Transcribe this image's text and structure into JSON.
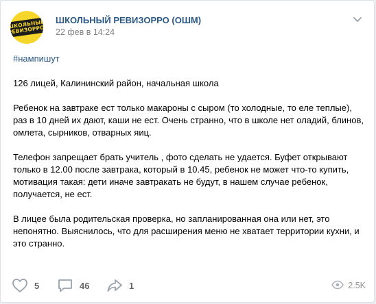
{
  "post": {
    "author": "ШКОЛЬНЫЙ РЕВИЗОРРО (ОШМ)",
    "date": "22 фев в 14:24",
    "avatar_text_line1": "ШКОЛЬНЫЙ",
    "avatar_text_line2": "РЕВИЗОРРО",
    "hashtag": "#нампишут",
    "paragraphs": [
      "126 лицей, Калининский район, начальная школа",
      "Ребенок на завтраке ест только макароны с сыром (то холодные, то еле теплые), раз в 10 дней их дают, каши не ест. Очень странно, что в школе нет оладий, блинов, омлета, сырников, отварных яиц.",
      "Телефон запрещает брать учитель , фото сделать не удается. Буфет открывают только в 12.00 после завтрака, который в 10.45, ребенок не может что-то купить, мотивация такая: дети иначе завтракать не будут, в нашем случае ребенок, получается, не ест.",
      "В лицее была родительская проверка, но запланированная она или нет, это непонятно. Выяснилось, что для расширения меню не хватает территории кухни, и это странно."
    ]
  },
  "actions": {
    "likes": "5",
    "comments": "46",
    "shares": "1",
    "views": "2.5K"
  },
  "icons": {
    "more": "chevron-down-icon",
    "like": "heart-icon",
    "comment": "comment-icon",
    "share": "share-icon",
    "views": "eye-icon"
  },
  "colors": {
    "link": "#2a5885",
    "avatar_bg": "#f6d62a",
    "icon": "#99a2ad"
  }
}
